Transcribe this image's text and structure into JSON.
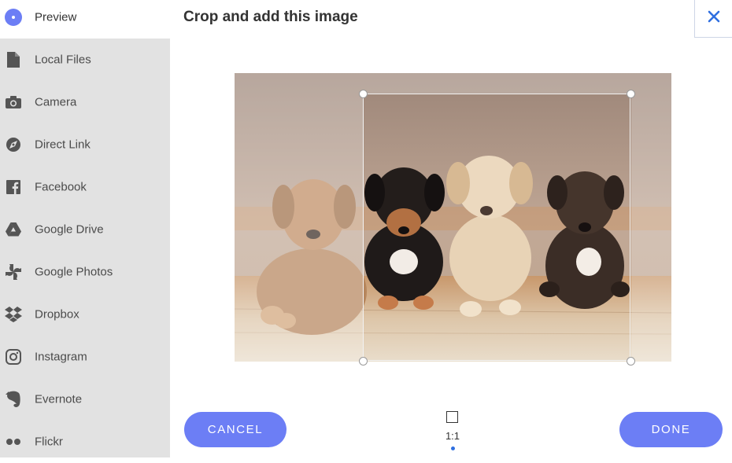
{
  "sidebar": {
    "items": [
      {
        "label": "Preview",
        "icon": "preview-dot-icon"
      },
      {
        "label": "Local Files",
        "icon": "file-icon"
      },
      {
        "label": "Camera",
        "icon": "camera-icon"
      },
      {
        "label": "Direct Link",
        "icon": "link-compass-icon"
      },
      {
        "label": "Facebook",
        "icon": "facebook-icon"
      },
      {
        "label": "Google Drive",
        "icon": "google-drive-icon"
      },
      {
        "label": "Google Photos",
        "icon": "google-photos-icon"
      },
      {
        "label": "Dropbox",
        "icon": "dropbox-icon"
      },
      {
        "label": "Instagram",
        "icon": "instagram-icon"
      },
      {
        "label": "Evernote",
        "icon": "evernote-icon"
      },
      {
        "label": "Flickr",
        "icon": "flickr-icon"
      }
    ]
  },
  "header": {
    "title": "Crop and add this image",
    "close_icon": "close-icon"
  },
  "crop": {
    "ratio_label": "1:1"
  },
  "actions": {
    "cancel_label": "CANCEL",
    "done_label": "DONE"
  },
  "colors": {
    "accent": "#6c7ef5",
    "sidebar_bg": "#e2e2e2",
    "close_icon": "#2f6fe0"
  }
}
